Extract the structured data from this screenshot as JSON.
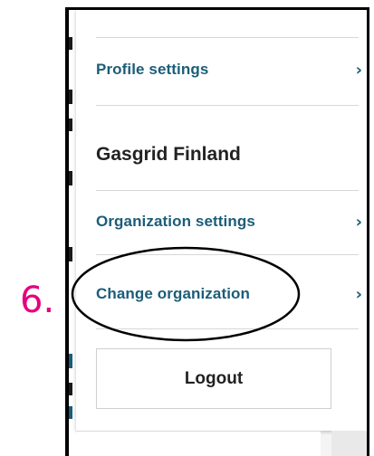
{
  "annotation": {
    "step_number": "6.",
    "step_color": "#e6007e"
  },
  "menu": {
    "profile_settings": {
      "label": "Profile settings",
      "chevron": "›"
    },
    "organization_name": "Gasgrid Finland",
    "organization_settings": {
      "label": "Organization settings",
      "chevron": "›"
    },
    "change_organization": {
      "label": "Change organization",
      "chevron": "›"
    },
    "logout_label": "Logout"
  },
  "colors": {
    "link": "#1c5d78",
    "text": "#222222",
    "divider": "#d7d7d7"
  },
  "icons": {
    "chevron": "chevron-right-icon"
  }
}
